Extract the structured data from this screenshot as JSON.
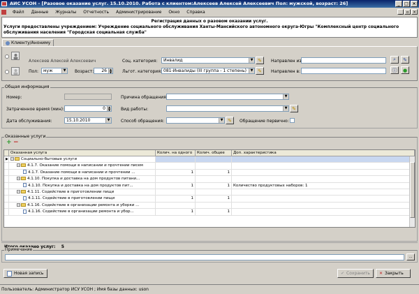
{
  "window": {
    "title": "АИС УСОН - [Разовое оказание услуг. 15.10.2010. Работа с клиентом:Алексеев Алексей Алексеевич Пол: мужской, возраст: 26]"
  },
  "menu": [
    "Файл",
    "Данные",
    "Журналы",
    "Отчетность",
    "Администрирование",
    "Окно",
    "Справка"
  ],
  "header": {
    "title": "Регистрация данных о разовом оказании услуг.",
    "institution_line1": "Услуги предоставлены учреждением: Учреждение социального обслуживания Ханты-Мансийского автономного округа-Югры \"Комплексный центр социального",
    "institution_line2": "обслуживания населения \"Городская социальная служба\""
  },
  "tab": {
    "label": "Клиенту/Анониму"
  },
  "client": {
    "name": "Алексеев Алексей Алексеевич",
    "gender_label": "Пол:",
    "gender_value": "муж",
    "age_label": "Возраст:",
    "age_value": "26",
    "soc_category_label": "Соц. категория:",
    "soc_category_value": "Инвалид",
    "lgot_category_label": "Льгот. категория:",
    "lgot_category_value": "081-Инвалиды (III группа - 1 степень)",
    "directed_from_label": "Направлен из:",
    "directed_from_value": "",
    "directed_to_label": "Направлен в:",
    "directed_to_value": ""
  },
  "general": {
    "title": "Общая информация",
    "number_label": "Номер:",
    "number_value": "",
    "time_label": "Затраченное время (мин):",
    "time_value": "0",
    "date_label": "Дата обслуживания:",
    "date_value": "15.10.2010",
    "reason_label": "Причина обращения:",
    "reason_value": "",
    "work_type_label": "Вид работы:",
    "work_type_value": "",
    "method_label": "Способ обращения:",
    "method_value": "",
    "first_visit_label": "Обращение первично:"
  },
  "services": {
    "title": "Оказанные услуги",
    "columns": [
      "Оказанная услуга",
      "Колич. на одного",
      "Колич. общее",
      "Доп. характеристика"
    ],
    "rows": [
      {
        "type": "folder",
        "indent": 0,
        "name": "Социально-бытовые услуги",
        "per_one": "",
        "total": "",
        "extra": ""
      },
      {
        "type": "folder",
        "indent": 1,
        "name": "4.1.7. Оказание помощи в написании и прочтении писем",
        "per_one": "",
        "total": "",
        "extra": ""
      },
      {
        "type": "doc",
        "indent": 2,
        "name": "4.1.7. Оказание помощи в написании и прочтении ...",
        "per_one": "1",
        "total": "1",
        "extra": ""
      },
      {
        "type": "folder",
        "indent": 1,
        "name": "4.1.10. Покупка и доставка на дом продуктов питани...",
        "per_one": "",
        "total": "",
        "extra": ""
      },
      {
        "type": "doc",
        "indent": 2,
        "name": "4.1.10. Покупка и доставка на дом продуктов пит...",
        "per_one": "1",
        "total": "1",
        "extra": "Количество продуктовых наборов: 1"
      },
      {
        "type": "folder",
        "indent": 1,
        "name": "4.1.11. Содействие в приготовлении пищи",
        "per_one": "",
        "total": "",
        "extra": ""
      },
      {
        "type": "doc",
        "indent": 2,
        "name": "4.1.11. Содействие в приготовлении пищи",
        "per_one": "1",
        "total": "1",
        "extra": ""
      },
      {
        "type": "folder",
        "indent": 1,
        "name": "4.1.16. Содействие в организации ремонта и уборки ...",
        "per_one": "",
        "total": "",
        "extra": ""
      },
      {
        "type": "doc",
        "indent": 2,
        "name": "4.1.16. Содействие в организации ремонта и убор...",
        "per_one": "1",
        "total": "1",
        "extra": ""
      }
    ],
    "total_label": "Итого оказано услуг:",
    "total_value": "5"
  },
  "note": {
    "title": "Примечание",
    "value": ""
  },
  "buttons": {
    "new_record": "Новая запись",
    "save": "Сохранить",
    "close": "Закрыть"
  },
  "status": {
    "text": "Пользователь: Администратор ИСУ УСОН  ;  Имя базы данных:  uson"
  },
  "colors": {
    "title_bar": "#0a246a",
    "selection": "#c8d7f0",
    "add_green": "#2a9a2a",
    "remove_red": "#c02020"
  }
}
